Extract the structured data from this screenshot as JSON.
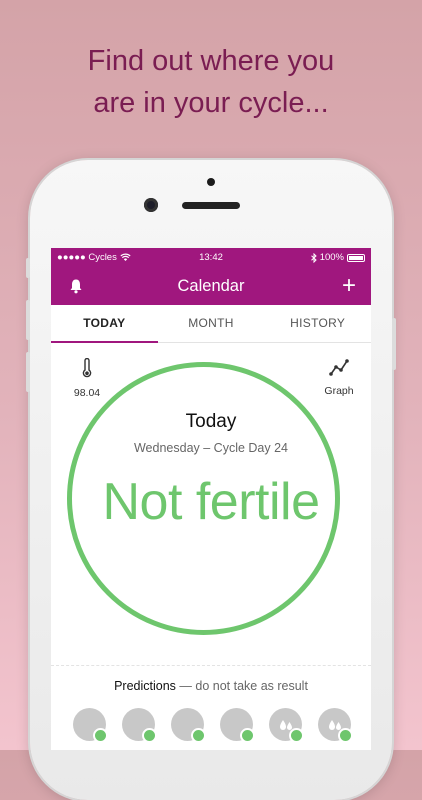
{
  "headline": {
    "line1": "Find out where you",
    "line2": "are in your cycle..."
  },
  "status_bar": {
    "carrier": "●●●●● Cycles",
    "time": "13:42",
    "battery": "100%"
  },
  "app_bar": {
    "title": "Calendar",
    "add_label": "+"
  },
  "tabs": [
    {
      "label": "TODAY",
      "active": true
    },
    {
      "label": "MONTH",
      "active": false
    },
    {
      "label": "HISTORY",
      "active": false
    }
  ],
  "temperature": {
    "value": "98.04"
  },
  "graph": {
    "label": "Graph"
  },
  "day": {
    "title": "Today",
    "subtitle": "Wednesday – Cycle Day 24",
    "status": "Not fertile"
  },
  "predictions": {
    "title": "Predictions",
    "note": "— do not take as result"
  },
  "colors": {
    "brand": "#a0177e",
    "fertility_green": "#6ec66d",
    "headline": "#7a1d52"
  },
  "prediction_icons": [
    "plain",
    "plain",
    "plain",
    "plain",
    "drops",
    "drops"
  ]
}
